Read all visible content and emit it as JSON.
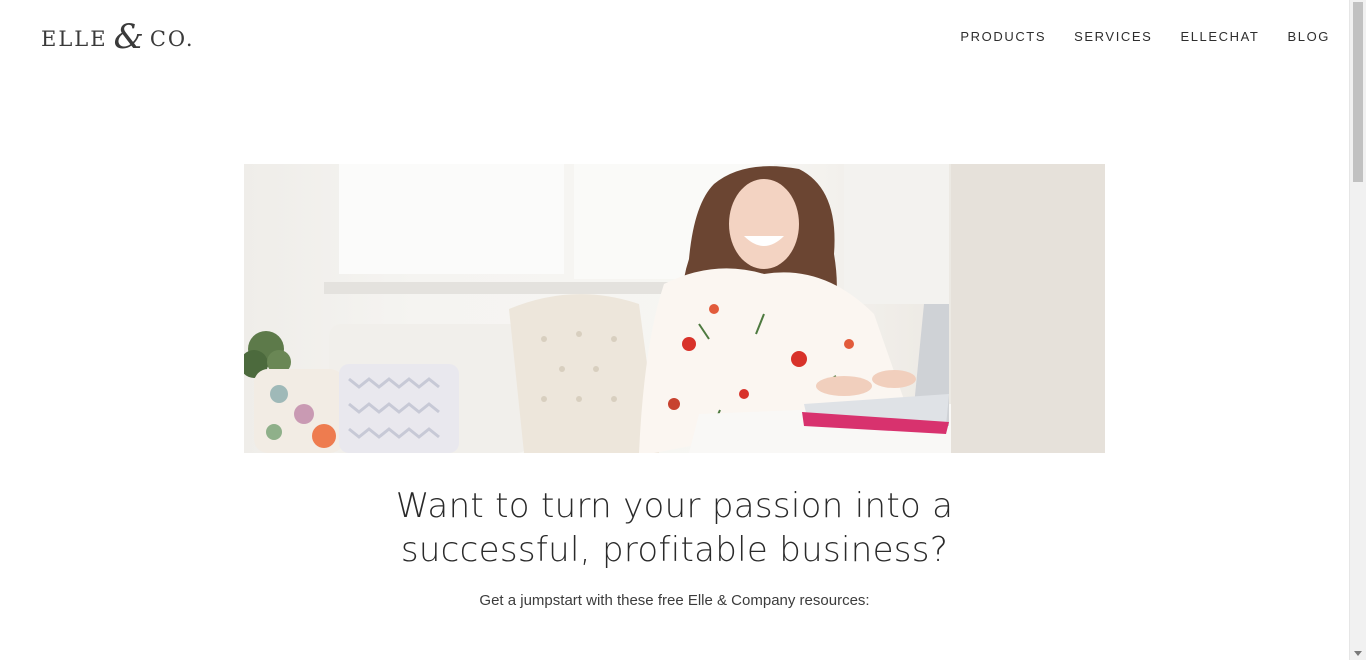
{
  "header": {
    "logo": {
      "word_left": "ELLE",
      "ampersand": "&",
      "word_right": "CO."
    },
    "nav": [
      {
        "label": "PRODUCTS"
      },
      {
        "label": "SERVICES"
      },
      {
        "label": "ELLECHAT"
      },
      {
        "label": "BLOG"
      }
    ]
  },
  "hero": {
    "icon": "photo-woman-laptop"
  },
  "main": {
    "headline_line1": "Want to turn your passion into a",
    "headline_line2": "successful, profitable business?",
    "subtext": "Get a jumpstart with these free Elle & Company resources:"
  },
  "colors": {
    "text": "#2b2b2b",
    "accent_pink": "#d8326e",
    "background": "#ffffff"
  }
}
